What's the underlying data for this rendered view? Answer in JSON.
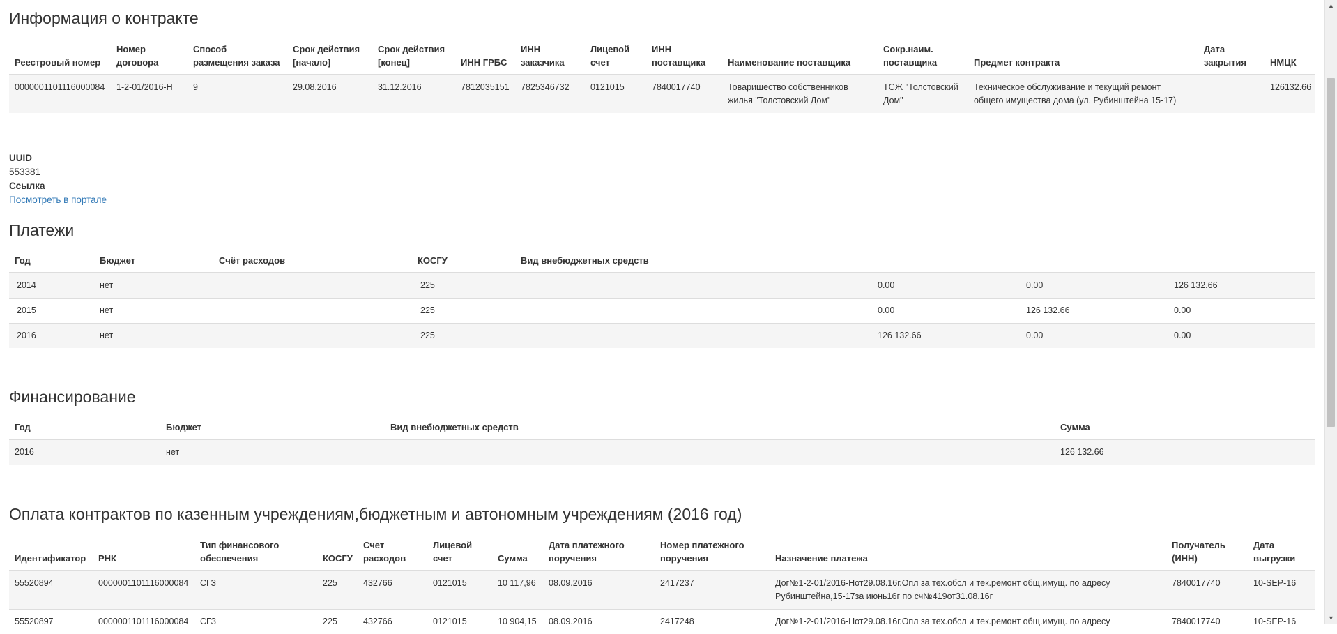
{
  "contract": {
    "title": "Информация о контракте",
    "headers": [
      "Реестровый номер",
      "Номер договора",
      "Способ размещения заказа",
      "Срок действия [начало]",
      "Срок действия [конец]",
      "ИНН ГРБС",
      "ИНН заказчика",
      "Лицевой счет",
      "ИНН поставщика",
      "Наименование поставщика",
      "Сокр.наим. поставщика",
      "Предмет контракта",
      "Дата закрытия",
      "НМЦК"
    ],
    "row": [
      "0000001101116000084",
      "1-2-01/2016-Н",
      "9",
      "29.08.2016",
      "31.12.2016",
      "7812035151",
      "7825346732",
      "0121015",
      "7840017740",
      "Товарищество собственников жилья \"Толстовский Дом\"",
      "ТСЖ \"Толстовский Дом\"",
      "Техническое обслуживание и текущий ремонт общего имущества дома (ул. Рубинштейна 15-17)",
      "",
      "126132.66"
    ]
  },
  "meta": {
    "uuid_label": "UUID",
    "uuid_value": "553381",
    "link_label": "Ссылка",
    "link_text": "Посмотреть в портале"
  },
  "payments": {
    "title": "Платежи",
    "headers": [
      "Год",
      "Бюджет",
      "Счёт расходов",
      "КОСГУ",
      "Вид внебюджетных средств",
      "",
      "",
      ""
    ],
    "rows": [
      [
        "2014",
        "нет",
        "",
        "225",
        "",
        "0.00",
        "0.00",
        "126 132.66"
      ],
      [
        "2015",
        "нет",
        "",
        "225",
        "",
        "0.00",
        "126 132.66",
        "0.00"
      ],
      [
        "2016",
        "нет",
        "",
        "225",
        "",
        "126 132.66",
        "0.00",
        "0.00"
      ]
    ]
  },
  "financing": {
    "title": "Финансирование",
    "headers": [
      "Год",
      "Бюджет",
      "Вид внебюджетных средств",
      "Сумма"
    ],
    "rows": [
      [
        "2016",
        "нет",
        "",
        "126 132.66"
      ]
    ]
  },
  "contract_payments": {
    "title": "Оплата контрактов по казенным учреждениям,бюджетным и автономным учреждениям (2016 год)",
    "headers": [
      "Идентификатор",
      "РНК",
      "Тип финансового обеспечения",
      "КОСГУ",
      "Счет расходов",
      "Лицевой счет",
      "Сумма",
      "Дата платежного поручения",
      "Номер платежного поручения",
      "Назначение платежа",
      "Получатель (ИНН)",
      "Дата выгрузки"
    ],
    "rows": [
      [
        "55520894",
        "0000001101116000084",
        "СГЗ",
        "225",
        "432766",
        "0121015",
        "10 117,96",
        "08.09.2016",
        "2417237",
        "Дог№1-2-01/2016-Нот29.08.16г.Опл за тех.обсл и тек.ремонт общ.имущ. по адресу Рубинштейна,15-17за июнь16г по сч№419от31.08.16г",
        "7840017740",
        "10-SEP-16"
      ],
      [
        "55520897",
        "0000001101116000084",
        "СГЗ",
        "225",
        "432766",
        "0121015",
        "10 904,15",
        "08.09.2016",
        "2417248",
        "Дог№1-2-01/2016-Нот29.08.16г.Опл за тех.обсл и тек.ремонт общ.имущ. по адресу",
        "7840017740",
        "10-SEP-16"
      ]
    ]
  },
  "scrollbar": {
    "up_icon": "▲",
    "down_icon": "▼"
  }
}
